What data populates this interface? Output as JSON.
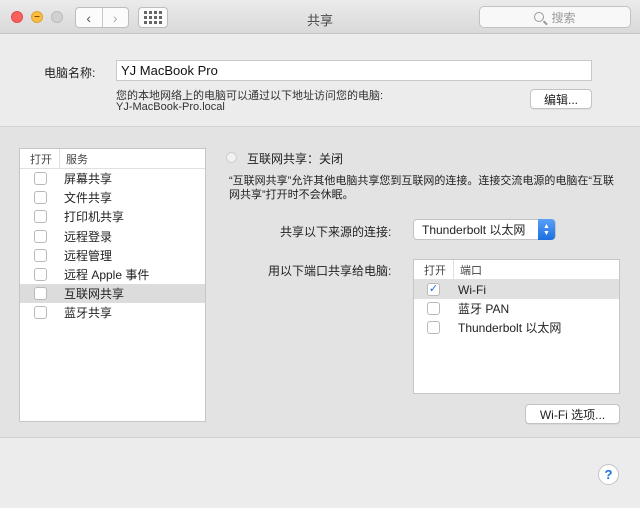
{
  "window": {
    "title": "共享"
  },
  "toolbar": {
    "back": "‹",
    "forward": "›",
    "search_placeholder": "搜索"
  },
  "computer_name": {
    "label": "电脑名称:",
    "value": "YJ MacBook Pro",
    "desc": "您的本地网络上的电脑可以通过以下地址访问您的电脑:",
    "address": "YJ-MacBook-Pro.local",
    "edit_button": "编辑..."
  },
  "services": {
    "col_on": "打开",
    "col_service": "服务",
    "items": [
      {
        "label": "屏幕共享",
        "checked": false,
        "selected": false
      },
      {
        "label": "文件共享",
        "checked": false,
        "selected": false
      },
      {
        "label": "打印机共享",
        "checked": false,
        "selected": false
      },
      {
        "label": "远程登录",
        "checked": false,
        "selected": false
      },
      {
        "label": "远程管理",
        "checked": false,
        "selected": false
      },
      {
        "label": "远程 Apple 事件",
        "checked": false,
        "selected": false
      },
      {
        "label": "互联网共享",
        "checked": false,
        "selected": true
      },
      {
        "label": "蓝牙共享",
        "checked": false,
        "selected": false
      }
    ]
  },
  "internet_sharing": {
    "title": "互联网共享：关闭",
    "desc_line1": "“互联网共享”允许其他电脑共享您到互联网的连接。连接交流电源的电脑在“互联",
    "desc_line2": "网共享”打开时不会休眠。",
    "from_label": "共享以下来源的连接:",
    "from_value": "Thunderbolt 以太网",
    "to_label": "用以下端口共享给电脑:",
    "col_on": "打开",
    "col_port": "端口",
    "ports": [
      {
        "label": "Wi-Fi",
        "checked": true,
        "selected": true
      },
      {
        "label": "蓝牙 PAN",
        "checked": false,
        "selected": false
      },
      {
        "label": "Thunderbolt 以太网",
        "checked": false,
        "selected": false
      }
    ],
    "wifi_options_button": "Wi-Fi 选项..."
  },
  "help": {
    "label": "?"
  },
  "colors": {
    "accent": "#1a6fe0",
    "close": "#fc605c",
    "minimize": "#fdbc40"
  }
}
